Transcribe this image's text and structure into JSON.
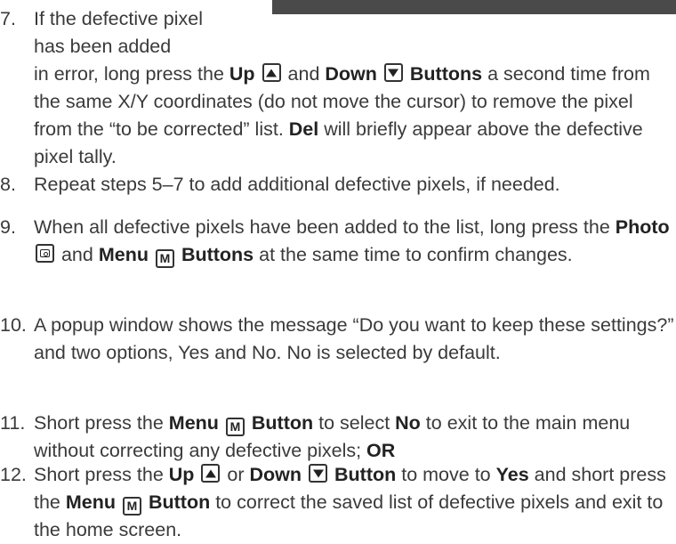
{
  "steps": [
    {
      "num": "7.",
      "line1": "If the defective pixel",
      "line2": "has been added",
      "parts": [
        "in error, long press the ",
        "Up",
        " and ",
        "Down",
        "Buttons",
        " a second time from the same X/Y coordinates (do not move the cursor) to remove the pixel from the “to be corrected” list. ",
        "Del",
        " will briefly appear above the defective pixel tally."
      ]
    },
    {
      "num": "8.",
      "text": "Repeat steps 5–7 to add additional defective pixels, if needed."
    },
    {
      "num": "9.",
      "parts": [
        "When all defective pixels have been added to the list, long press the ",
        "Photo",
        " and ",
        "Menu",
        "Buttons",
        " at the same time to confirm changes."
      ]
    },
    {
      "num": "10.",
      "text": "A popup window shows the message “Do you want to keep these settings?” and two options, Yes and No. No is selected by default."
    },
    {
      "num": "11.",
      "parts": [
        "Short press the ",
        "Menu",
        "Button",
        " to select ",
        "No",
        " to exit to the main menu without correcting any defective pixels; ",
        "OR"
      ]
    },
    {
      "num": "12.",
      "parts": [
        "Short press the ",
        "Up",
        " or ",
        "Down",
        "Button",
        " to move to ",
        "Yes",
        " and short press the ",
        "Menu",
        "Button",
        " to correct the saved list of defective pixels and exit to the home screen."
      ]
    }
  ],
  "icons": {
    "up": "up-arrow-button-icon",
    "down": "down-arrow-button-icon",
    "photo": "camera-button-icon",
    "menu": "menu-m-button-icon"
  },
  "menu_icon_letter": "M"
}
